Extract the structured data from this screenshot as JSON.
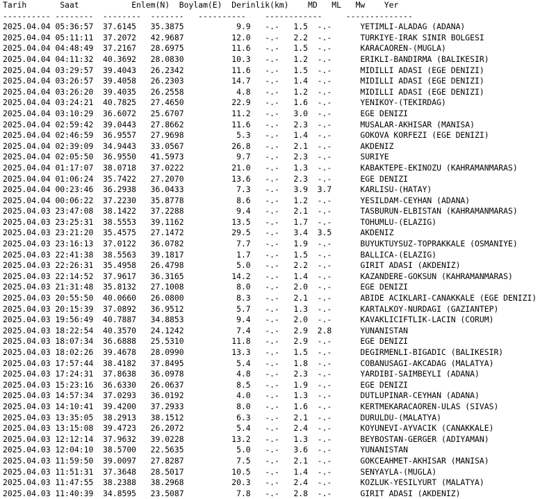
{
  "columns": [
    "Tarih",
    "Saat",
    "Enlem(N)",
    "Boylam(E)",
    "Derinlik(km)",
    "MD",
    "ML",
    "Mw",
    "Yer"
  ],
  "rows": [
    [
      "2025.04.04",
      "05:36:57",
      "37.6145",
      "35.3875",
      "9.9",
      "-.-",
      "1.5",
      "-.-",
      "YETIMLI-ALADAG (ADANA)"
    ],
    [
      "2025.04.04",
      "05:11:11",
      "37.2072",
      "42.9687",
      "12.0",
      "-.-",
      "2.2",
      "-.-",
      "TURKIYE-IRAK SINIR BOLGESI"
    ],
    [
      "2025.04.04",
      "04:48:49",
      "37.2167",
      "28.6975",
      "11.6",
      "-.-",
      "1.5",
      "-.-",
      "KARACAOREN-(MUGLA)"
    ],
    [
      "2025.04.04",
      "04:11:32",
      "40.3692",
      "28.0830",
      "10.3",
      "-.-",
      "1.2",
      "-.-",
      "ERIKLI-BANDIRMA (BALIKESIR)"
    ],
    [
      "2025.04.04",
      "03:29:57",
      "39.4043",
      "26.2342",
      "11.6",
      "-.-",
      "1.5",
      "-.-",
      "MIDILLI ADASI (EGE DENIZI)"
    ],
    [
      "2025.04.04",
      "03:26:57",
      "39.4058",
      "26.2303",
      "14.7",
      "-.-",
      "1.4",
      "-.-",
      "MIDILLI ADASI (EGE DENIZI)"
    ],
    [
      "2025.04.04",
      "03:26:20",
      "39.4035",
      "26.2558",
      "4.8",
      "-.-",
      "1.2",
      "-.-",
      "MIDILLI ADASI (EGE DENIZI)"
    ],
    [
      "2025.04.04",
      "03:24:21",
      "40.7825",
      "27.4650",
      "22.9",
      "-.-",
      "1.6",
      "-.-",
      "YENIKOY-(TEKIRDAG)"
    ],
    [
      "2025.04.04",
      "03:10:29",
      "36.6072",
      "25.6707",
      "11.2",
      "-.-",
      "3.0",
      "-.-",
      "EGE DENIZI"
    ],
    [
      "2025.04.04",
      "02:59:42",
      "39.0443",
      "27.8662",
      "11.6",
      "-.-",
      "2.3",
      "-.-",
      "MUSALAR-AKHISAR (MANISA)"
    ],
    [
      "2025.04.04",
      "02:46:59",
      "36.9557",
      "27.9698",
      "5.3",
      "-.-",
      "1.4",
      "-.-",
      "GOKOVA KORFEZI (EGE DENIZI)"
    ],
    [
      "2025.04.04",
      "02:39:09",
      "34.9443",
      "33.0567",
      "26.8",
      "-.-",
      "2.1",
      "-.-",
      "AKDENIZ"
    ],
    [
      "2025.04.04",
      "02:05:50",
      "36.9550",
      "41.5973",
      "9.7",
      "-.-",
      "2.3",
      "-.-",
      "SURIYE"
    ],
    [
      "2025.04.04",
      "01:17:07",
      "38.0718",
      "37.0222",
      "21.0",
      "-.-",
      "1.3",
      "-.-",
      "KABAKTEPE-EKINOZU (KAHRAMANMARAS)"
    ],
    [
      "2025.04.04",
      "01:06:24",
      "35.7422",
      "27.2070",
      "13.6",
      "-.-",
      "2.3",
      "-.-",
      "EGE DENIZI"
    ],
    [
      "2025.04.04",
      "00:23:46",
      "36.2938",
      "36.0433",
      "7.3",
      "-.-",
      "3.9",
      "3.7",
      "KARLISU-(HATAY)"
    ],
    [
      "2025.04.04",
      "00:06:22",
      "37.2230",
      "35.8778",
      "8.6",
      "-.-",
      "1.2",
      "-.-",
      "YESILDAM-CEYHAN (ADANA)"
    ],
    [
      "2025.04.03",
      "23:47:08",
      "38.1422",
      "37.2288",
      "9.4",
      "-.-",
      "2.1",
      "-.-",
      "TASBURUN-ELBISTAN (KAHRAMANMARAS)"
    ],
    [
      "2025.04.03",
      "23:25:31",
      "38.5553",
      "39.1162",
      "13.5",
      "-.-",
      "1.7",
      "-.-",
      "TOHUMLU-(ELAZIG)"
    ],
    [
      "2025.04.03",
      "23:21:20",
      "35.4575",
      "27.1472",
      "29.5",
      "-.-",
      "3.4",
      "3.5",
      "AKDENIZ"
    ],
    [
      "2025.04.03",
      "23:16:13",
      "37.0122",
      "36.0782",
      "7.7",
      "-.-",
      "1.9",
      "-.-",
      "BUYUKTUYSUZ-TOPRAKKALE (OSMANIYE)"
    ],
    [
      "2025.04.03",
      "22:41:38",
      "38.5563",
      "39.1817",
      "1.7",
      "-.-",
      "1.5",
      "-.-",
      "BALLICA-(ELAZIG)"
    ],
    [
      "2025.04.03",
      "22:26:31",
      "35.4958",
      "26.4798",
      "5.0",
      "-.-",
      "2.2",
      "-.-",
      "GIRIT ADASI (AKDENIZ)"
    ],
    [
      "2025.04.03",
      "22:14:52",
      "37.9617",
      "36.3165",
      "14.2",
      "-.-",
      "1.4",
      "-.-",
      "KAZANDERE-GOKSUN (KAHRAMANMARAS)"
    ],
    [
      "2025.04.03",
      "21:31:48",
      "35.8132",
      "27.1008",
      "8.0",
      "-.-",
      "2.0",
      "-.-",
      "EGE DENIZI"
    ],
    [
      "2025.04.03",
      "20:55:50",
      "40.0660",
      "26.0800",
      "8.3",
      "-.-",
      "2.1",
      "-.-",
      "ABIDE ACIKLARI-CANAKKALE (EGE DENIZI)"
    ],
    [
      "2025.04.03",
      "20:15:39",
      "37.0892",
      "36.9512",
      "5.7",
      "-.-",
      "1.3",
      "-.-",
      "KARTALKOY-NURDAGI (GAZIANTEP)"
    ],
    [
      "2025.04.03",
      "19:56:49",
      "40.7887",
      "34.8853",
      "9.4",
      "-.-",
      "2.0",
      "-.-",
      "KAVAKLICIFTLIK-LACIN (CORUM)"
    ],
    [
      "2025.04.03",
      "18:22:54",
      "40.3570",
      "24.1242",
      "7.4",
      "-.-",
      "2.9",
      "2.8",
      "YUNANISTAN"
    ],
    [
      "2025.04.03",
      "18:07:34",
      "36.6888",
      "25.5310",
      "11.8",
      "-.-",
      "2.9",
      "-.-",
      "EGE DENIZI"
    ],
    [
      "2025.04.03",
      "18:02:26",
      "39.4678",
      "28.0990",
      "13.3",
      "-.-",
      "1.5",
      "-.-",
      "DEGIRMENLI-BIGADIC (BALIKESIR)"
    ],
    [
      "2025.04.03",
      "17:57:44",
      "38.4182",
      "37.8495",
      "5.4",
      "-.-",
      "1.8",
      "-.-",
      "COBANUSAGI-AKCADAG (MALATYA)"
    ],
    [
      "2025.04.03",
      "17:24:31",
      "37.8638",
      "36.0978",
      "4.8",
      "-.-",
      "2.3",
      "-.-",
      "YARDIBI-SAIMBEYLI (ADANA)"
    ],
    [
      "2025.04.03",
      "15:23:16",
      "36.6330",
      "26.0637",
      "8.5",
      "-.-",
      "1.9",
      "-.-",
      "EGE DENIZI"
    ],
    [
      "2025.04.03",
      "14:57:34",
      "37.0293",
      "36.0192",
      "4.0",
      "-.-",
      "1.3",
      "-.-",
      "DUTLUPINAR-CEYHAN (ADANA)"
    ],
    [
      "2025.04.03",
      "14:10:41",
      "39.4200",
      "37.2933",
      "8.0",
      "-.-",
      "1.6",
      "-.-",
      "KERTMEKARACAOREN-ULAS (SIVAS)"
    ],
    [
      "2025.04.03",
      "13:35:05",
      "38.2913",
      "38.1512",
      "6.3",
      "-.-",
      "2.1",
      "-.-",
      "DURULDU-(MALATYA)"
    ],
    [
      "2025.04.03",
      "13:15:08",
      "39.4723",
      "26.2072",
      "5.4",
      "-.-",
      "2.4",
      "-.-",
      "KOYUNEVI-AYVACIK (CANAKKALE)"
    ],
    [
      "2025.04.03",
      "12:12:14",
      "37.9632",
      "39.0228",
      "13.2",
      "-.-",
      "1.3",
      "-.-",
      "BEYBOSTAN-GERGER (ADIYAMAN)"
    ],
    [
      "2025.04.03",
      "12:04:10",
      "38.5700",
      "22.5635",
      "5.0",
      "-.-",
      "3.6",
      "-.-",
      "YUNANISTAN"
    ],
    [
      "2025.04.03",
      "11:59:50",
      "39.0097",
      "27.8287",
      "7.5",
      "-.-",
      "2.1",
      "-.-",
      "GOKCEAHMET-AKHISAR (MANISA)"
    ],
    [
      "2025.04.03",
      "11:51:31",
      "37.3648",
      "28.5017",
      "10.5",
      "-.-",
      "1.4",
      "-.-",
      "SENYAYLA-(MUGLA)"
    ],
    [
      "2025.04.03",
      "11:47:55",
      "38.2388",
      "38.2968",
      "20.3",
      "-.-",
      "2.4",
      "-.-",
      "KOZLUK-YESILYURT (MALATYA)"
    ],
    [
      "2025.04.03",
      "11:40:39",
      "34.8595",
      "23.5087",
      "7.8",
      "-.-",
      "2.8",
      "-.-",
      "GIRIT ADASI (AKDENIZ)"
    ]
  ]
}
